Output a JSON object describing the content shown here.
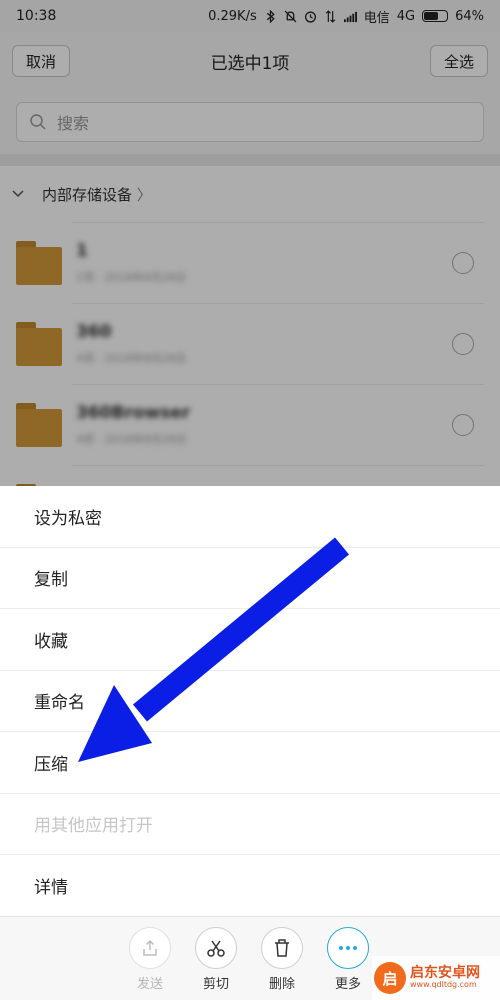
{
  "status_bar": {
    "time": "10:38",
    "speed": "0.29K/s",
    "carrier": "电信",
    "network": "4G",
    "battery": "64%",
    "battery_level": 0.64
  },
  "topbar": {
    "cancel_label": "取消",
    "title": "已选中1项",
    "select_all_label": "全选"
  },
  "search": {
    "placeholder": "搜索"
  },
  "path": {
    "label": "内部存储设备",
    "chevron": "〉"
  },
  "folders": [
    {
      "name": "1",
      "meta": "1项 · 2018年8月28日"
    },
    {
      "name": "360",
      "meta": "4项 · 2018年8月28日"
    },
    {
      "name": "360Browser",
      "meta": "4项 · 2018年8月28日"
    }
  ],
  "menu": {
    "items": [
      {
        "label": "设为私密",
        "enabled": true
      },
      {
        "label": "复制",
        "enabled": true
      },
      {
        "label": "收藏",
        "enabled": true
      },
      {
        "label": "重命名",
        "enabled": true
      },
      {
        "label": "压缩",
        "enabled": true
      },
      {
        "label": "用其他应用打开",
        "enabled": false
      },
      {
        "label": "详情",
        "enabled": true
      }
    ]
  },
  "actions": [
    {
      "label": "发送",
      "icon": "share-icon",
      "enabled": false
    },
    {
      "label": "剪切",
      "icon": "scissors-icon",
      "enabled": true
    },
    {
      "label": "删除",
      "icon": "trash-icon",
      "enabled": true
    },
    {
      "label": "更多",
      "icon": "more-icon",
      "enabled": true,
      "active": true
    }
  ],
  "watermark": {
    "title": "启东安卓网",
    "url": "www.qdltdg.com"
  },
  "colors": {
    "accent": "#29a8e0",
    "folder": "#d39a3a",
    "arrow": "#0a1ee6",
    "watermark": "#f26b1d"
  }
}
